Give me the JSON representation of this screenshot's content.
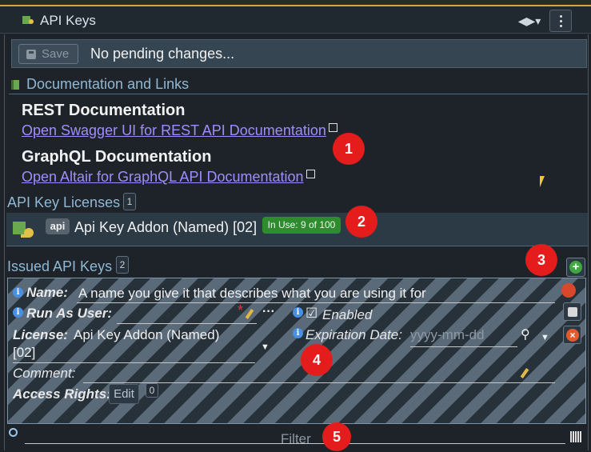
{
  "window": {
    "title": "API Keys"
  },
  "toolbar": {
    "save_label": "Save",
    "status": "No pending changes..."
  },
  "documentation": {
    "section_title": "Documentation and Links",
    "rest_heading": "REST Documentation",
    "rest_link": "Open Swagger UI for REST API Documentation",
    "graphql_heading": "GraphQL Documentation",
    "graphql_link": "Open Altair for GraphQL API Documentation"
  },
  "licenses": {
    "section_title": "API Key Licenses",
    "count": "1",
    "items": [
      {
        "tag": "api",
        "name": "Api Key Addon (Named) [02]",
        "in_use": "In Use: 9 of 100"
      }
    ]
  },
  "issued": {
    "section_title": "Issued API Keys",
    "count": "2",
    "key": {
      "name_label": "Name:",
      "name_value": "A name you give it that describes what you are using it for",
      "run_as_label": "Run As User:",
      "required_mark": "*",
      "more_label": "···",
      "enabled_label": "Enabled",
      "license_label": "License:",
      "license_value_line1": "Api Key Addon (Named)",
      "license_value_line2": "[02]",
      "expiration_label": "Expiration Date:",
      "expiration_placeholder": "yyyy-mm-dd",
      "comment_label": "Comment:",
      "access_label": "Access Rights:",
      "edit_label": "Edit",
      "access_count": "0"
    }
  },
  "filter": {
    "placeholder": "Filter"
  },
  "callouts": [
    "1",
    "2",
    "3",
    "4",
    "5"
  ],
  "colors": {
    "accent": "#d4a64a",
    "link": "#a08cff",
    "callout": "#e51c1c",
    "in_use": "#2e8b2e"
  }
}
